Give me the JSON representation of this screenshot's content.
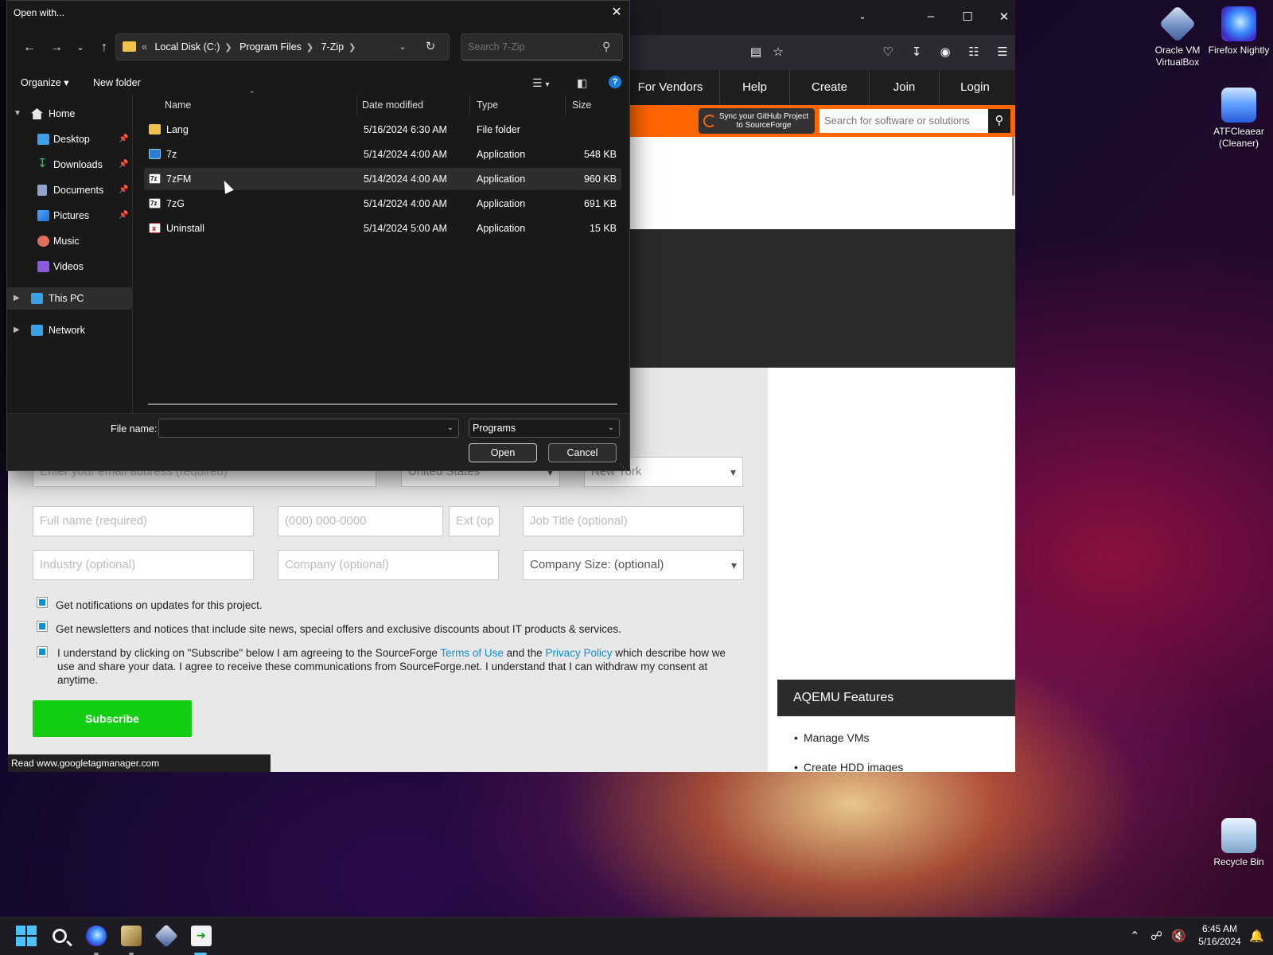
{
  "desktop": {
    "icons": [
      {
        "label": "Oracle VM VirtualBox"
      },
      {
        "label": "Firefox Nightly"
      },
      {
        "label": "ATFCleaear (Cleaner)"
      },
      {
        "label": "Recycle Bin"
      }
    ]
  },
  "browser": {
    "nav": [
      "For Vendors",
      "Help",
      "Create",
      "Join",
      "Login"
    ],
    "sync_button": "Sync your GitHub Project to SourceForge",
    "search_placeholder": "Search for software or solutions",
    "form": {
      "email_placeholder": "Enter your email address (required)",
      "country": "United States",
      "state": "New York",
      "fullname_placeholder": "Full name (required)",
      "phone_placeholder": "(000) 000-0000",
      "ext_placeholder": "Ext (op",
      "jobtitle_placeholder": "Job Title  (optional)",
      "industry_placeholder": "Industry  (optional)",
      "company_placeholder": "Company  (optional)",
      "company_size": "Company Size: (optional)",
      "check1": "Get notifications on updates for this project.",
      "check2": "Get newsletters and notices that include site news, special offers and exclusive discounts about IT products & services.",
      "consent_pre": "I understand by clicking on \"Subscribe\" below I am agreeing to the SourceForge ",
      "terms_link": "Terms of Use",
      "consent_mid": " and the ",
      "privacy_link": "Privacy Policy",
      "consent_post": " which describe how we use and share your data. I agree to receive these communications from SourceForge.net. I understand that I can withdraw my consent at anytime.",
      "subscribe": "Subscribe"
    },
    "features": {
      "title": "AQEMU Features",
      "items": [
        "Manage VMs",
        "Create HDD images"
      ]
    },
    "status_text": "Read www.googletagmanager.com"
  },
  "dialog": {
    "title": "Open with...",
    "breadcrumb": {
      "prefix": "«",
      "items": [
        "Local Disk (C:)",
        "Program Files",
        "7-Zip"
      ]
    },
    "search_placeholder": "Search 7-Zip",
    "organize": "Organize ▾",
    "new_folder": "New folder",
    "nav": [
      {
        "label": "Home"
      },
      {
        "label": "Desktop"
      },
      {
        "label": "Downloads"
      },
      {
        "label": "Documents"
      },
      {
        "label": "Pictures"
      },
      {
        "label": "Music"
      },
      {
        "label": "Videos"
      },
      {
        "label": "This PC"
      },
      {
        "label": "Network"
      }
    ],
    "columns": [
      "Name",
      "Date modified",
      "Type",
      "Size"
    ],
    "files": [
      {
        "name": "Lang",
        "date": "5/16/2024 6:30 AM",
        "type": "File folder",
        "size": ""
      },
      {
        "name": "7z",
        "date": "5/14/2024 4:00 AM",
        "type": "Application",
        "size": "548 KB"
      },
      {
        "name": "7zFM",
        "date": "5/14/2024 4:00 AM",
        "type": "Application",
        "size": "960 KB"
      },
      {
        "name": "7zG",
        "date": "5/14/2024 4:00 AM",
        "type": "Application",
        "size": "691 KB"
      },
      {
        "name": "Uninstall",
        "date": "5/14/2024 5:00 AM",
        "type": "Application",
        "size": "15 KB"
      }
    ],
    "file_name_label": "File name:",
    "file_name_value": "",
    "file_type": "Programs",
    "open_button": "Open",
    "cancel_button": "Cancel"
  },
  "taskbar": {
    "time": "6:45 AM",
    "date": "5/16/2024"
  }
}
